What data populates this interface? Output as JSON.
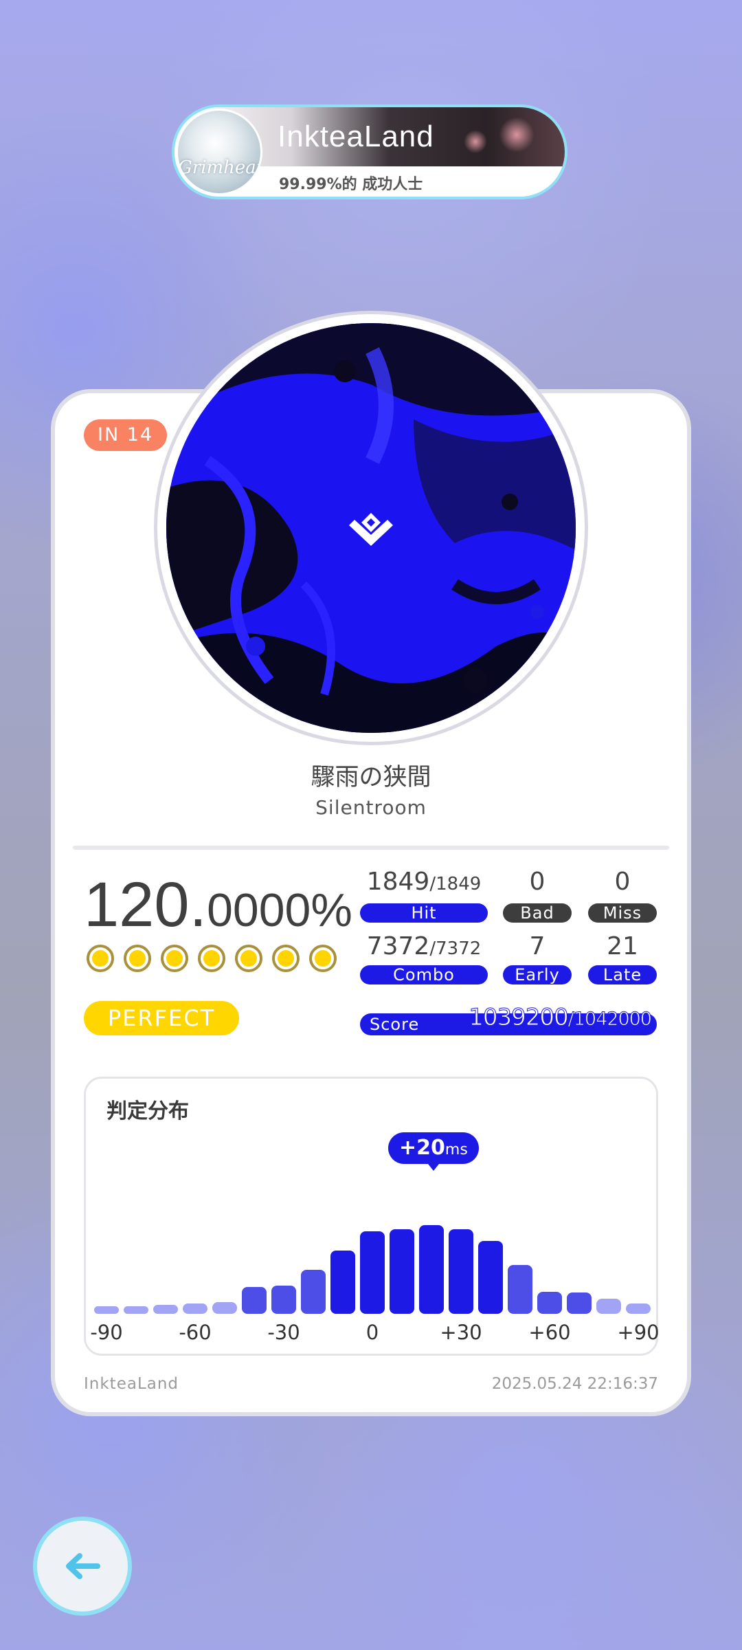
{
  "player": {
    "name": "InkteaLand",
    "rank_title": "99.99%的 成功人士",
    "avatar_signature": "Grimheart"
  },
  "song": {
    "difficulty": "IN  14",
    "title": "驟雨の狭間",
    "artist": "Silentroom"
  },
  "result": {
    "accuracy_int": "120.",
    "accuracy_dec": "0000%",
    "grade": "PERFECT",
    "coins_count": 7
  },
  "stats": {
    "hit": {
      "value": "1849",
      "total": "/1849",
      "label": "Hit"
    },
    "bad": {
      "value": "0",
      "label": "Bad"
    },
    "miss": {
      "value": "0",
      "label": "Miss"
    },
    "combo": {
      "value": "7372",
      "total": "/7372",
      "label": "Combo"
    },
    "early": {
      "value": "7",
      "label": "Early"
    },
    "late": {
      "value": "21",
      "label": "Late"
    },
    "score": {
      "label": "Score",
      "value": "1039200",
      "total": "/1042000"
    }
  },
  "distribution": {
    "title": "判定分布",
    "peak_value": "+20",
    "peak_unit": "ms"
  },
  "chart_data": {
    "type": "bar",
    "x": [
      -90,
      -80,
      -70,
      -60,
      -50,
      -40,
      -30,
      -20,
      -10,
      0,
      10,
      20,
      30,
      40,
      50,
      60,
      70,
      80,
      90
    ],
    "values": [
      8,
      8,
      9,
      11,
      12,
      28,
      29,
      46,
      66,
      86,
      88,
      92,
      88,
      76,
      51,
      23,
      22,
      16,
      11
    ],
    "tick_labels": [
      "-90",
      "-60",
      "-30",
      "0",
      "+30",
      "+60",
      "+90"
    ],
    "tick_values": [
      -90,
      -60,
      -30,
      0,
      30,
      60,
      90
    ],
    "ylim": [
      0,
      100
    ],
    "colors": {
      "low": "#a1a3f5",
      "mid": "#4d4de8",
      "high": "#1d1ae6"
    }
  },
  "footer": {
    "user": "InkteaLand",
    "timestamp": "2025.05.24 22:16:37"
  },
  "icons": {
    "back": "arrow-left-icon",
    "cover_logo": "diamond-logo-icon"
  },
  "colors": {
    "accent": "#1d1ae6",
    "difficulty": "#f88262",
    "grade": "#ffd600",
    "ring": "#8fe0f5"
  }
}
